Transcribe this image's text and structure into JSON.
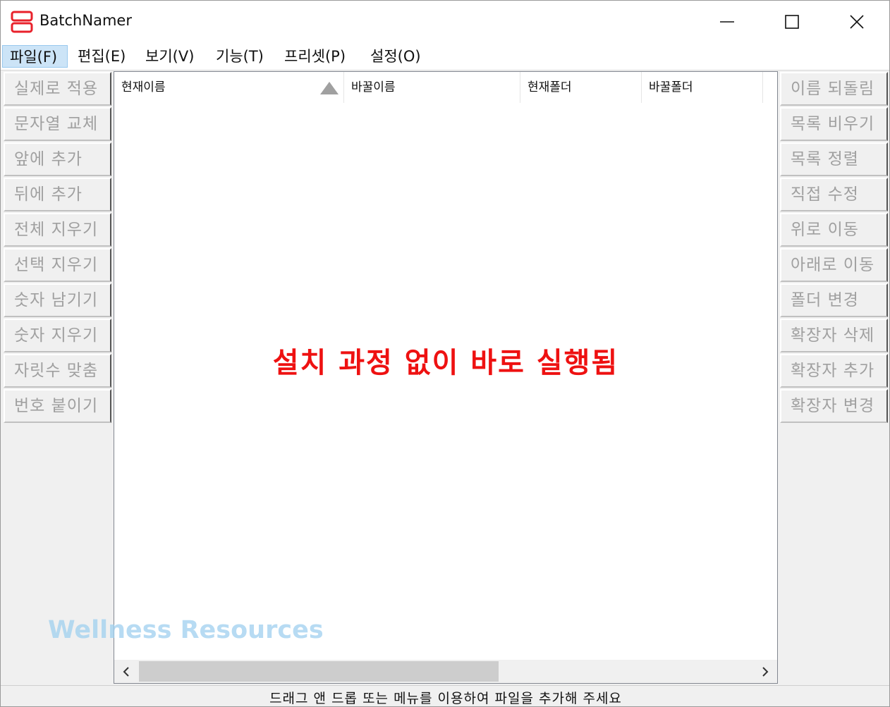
{
  "window": {
    "title": "BatchNamer",
    "app_icon": "batchnamer-logo-icon",
    "controls": [
      "minimize-icon",
      "maximize-icon",
      "close-icon"
    ],
    "accent_color": "#e8212b"
  },
  "menu": {
    "items": [
      "파일(F)",
      "편집(E)",
      "보기(V)",
      "기능(T)",
      "프리셋(P)",
      "설정(O)"
    ]
  },
  "left_buttons": [
    "실제로 적용",
    "문자열 교체",
    "앞에 추가",
    "뒤에 추가",
    "전체 지우기",
    "선택 지우기",
    "숫자 남기기",
    "숫자 지우기",
    "자릿수 맞춤",
    "번호 붙이기"
  ],
  "right_buttons": [
    "이름 되돌림",
    "목록 비우기",
    "목록 정렬",
    "직접 수정",
    "위로 이동",
    "아래로 이동",
    "폴더 변경",
    "확장자 삭제",
    "확장자 추가",
    "확장자 변경"
  ],
  "list": {
    "columns": [
      "현재이름",
      "바꿀이름",
      "현재폴더",
      "바꿀폴더"
    ],
    "sort_indicator": "sort-ascending-icon",
    "overlay_text": "설치 과정 없이 바로 실행됨",
    "overlay_color": "#ee1111",
    "watermark": "Wellness Resources"
  },
  "status": {
    "text": "드래그 앤 드롭 또는 메뉴를 이용하여 파일을 추가해 주세요"
  }
}
